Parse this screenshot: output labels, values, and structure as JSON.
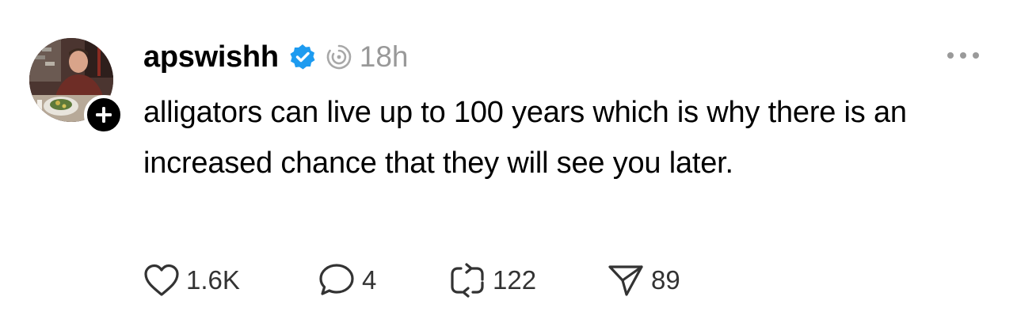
{
  "post": {
    "username": "apswishh",
    "timestamp": "18h",
    "text": "alligators can live up to 100 years which is why there is an increased chance that they will see you later.",
    "verified": true,
    "icons": {
      "verified": "verified-badge-icon",
      "thread": "thread-indicator-icon",
      "more": "more-options-icon",
      "follow": "plus-icon"
    },
    "colors": {
      "verified": "#1d9bf0",
      "muted": "#999999"
    }
  },
  "actions": {
    "likes": "1.6K",
    "replies": "4",
    "reposts": "122",
    "shares": "89"
  }
}
